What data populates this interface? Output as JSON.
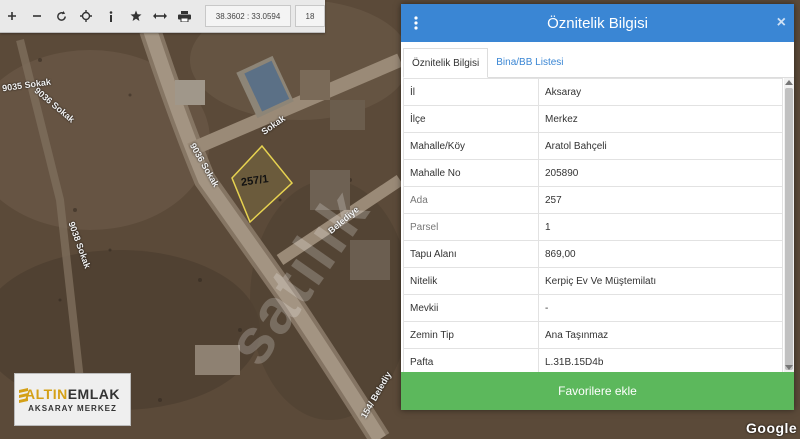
{
  "toolbar": {
    "buttons": [
      {
        "name": "zoom-in-icon",
        "glyph": "+"
      },
      {
        "name": "zoom-out-icon",
        "glyph": "−"
      },
      {
        "name": "refresh-icon",
        "glyph": "⟳"
      },
      {
        "name": "locate-icon",
        "glyph": "⌖"
      },
      {
        "name": "info-icon",
        "glyph": "i"
      },
      {
        "name": "star-icon",
        "glyph": "★"
      },
      {
        "name": "measure-icon",
        "glyph": "↔"
      },
      {
        "name": "print-icon",
        "glyph": "⎙"
      }
    ],
    "coordinates": "38.3602 : 33.0594",
    "zoom_level": "18"
  },
  "map": {
    "parcel_label": "257/1",
    "streets": [
      "9035 Sokak",
      "9036 Sokak",
      "9036 Sokak",
      "9038 Sokak",
      "Sokak",
      "Belediye",
      "154/ Belediy"
    ],
    "watermark": "satılık",
    "google": "Google"
  },
  "logo": {
    "brand_part1": "ALTIN",
    "brand_part2": "EMLAK",
    "subtitle": "AKSARAY MERKEZ"
  },
  "panel": {
    "title": "Öznitelik Bilgisi",
    "close": "×",
    "tabs": [
      "Öznitelik Bilgisi",
      "Bina/BB Listesi"
    ],
    "rows": [
      {
        "key": "İl",
        "value": "Aksaray"
      },
      {
        "key": "İlçe",
        "value": "Merkez"
      },
      {
        "key": "Mahalle/Köy",
        "value": "Aratol Bahçeli"
      },
      {
        "key": "Mahalle No",
        "value": "205890"
      },
      {
        "key": "Ada",
        "value": "257"
      },
      {
        "key": "Parsel",
        "value": "1"
      },
      {
        "key": "Tapu Alanı",
        "value": "869,00"
      },
      {
        "key": "Nitelik",
        "value": "Kerpiç Ev Ve Müştemilatı"
      },
      {
        "key": "Mevkii",
        "value": "-"
      },
      {
        "key": "Zemin Tip",
        "value": "Ana Taşınmaz"
      },
      {
        "key": "Pafta",
        "value": "L.31B.15D4b"
      }
    ],
    "favorite_button": "Favorilere ekle"
  },
  "colors": {
    "header": "#3a86d4",
    "favorite": "#5cb85c"
  }
}
